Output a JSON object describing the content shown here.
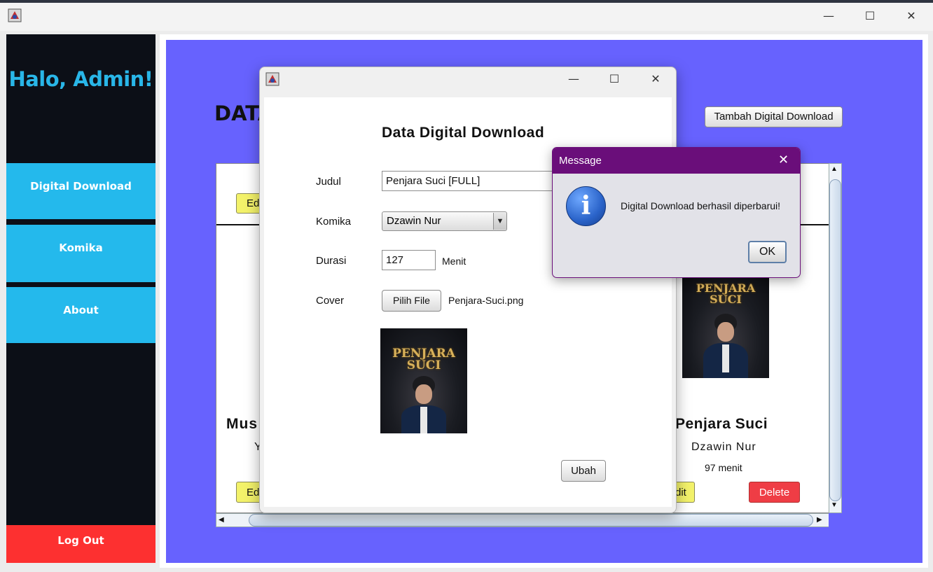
{
  "window": {
    "controls": {
      "minimize": "—",
      "maximize": "☐",
      "close": "✕"
    }
  },
  "sidebar": {
    "greeting": "Halo, Admin!",
    "items": [
      {
        "label": "Digital Download"
      },
      {
        "label": "Komika"
      },
      {
        "label": "About"
      }
    ],
    "logout": "Log Out"
  },
  "main": {
    "title_visible": "DATA",
    "add_button": "Tambah Digital Download",
    "cards": [
      {
        "title_visible": "Mus",
        "comic_visible": "Y",
        "edit_visible": "Ed",
        "top_edit_visible": "Ed"
      },
      {
        "title": "Penjara Suci",
        "comic": "Dzawin Nur",
        "duration": "97 menit",
        "edit_visible": "dit",
        "delete": "Delete",
        "poster_title": "PENJARA SUCI"
      }
    ]
  },
  "form_dialog": {
    "heading": "Data Digital Download",
    "fields": {
      "judul_label": "Judul",
      "judul_value": "Penjara Suci [FULL]",
      "komika_label": "Komika",
      "komika_value": "Dzawin Nur",
      "durasi_label": "Durasi",
      "durasi_value": "127",
      "durasi_unit": "Menit",
      "cover_label": "Cover",
      "cover_button": "Pilih File",
      "cover_file": "Penjara-Suci.png"
    },
    "preview_title": "PENJARA SUCI",
    "submit": "Ubah"
  },
  "message_dialog": {
    "title": "Message",
    "text": "Digital Download berhasil diperbarui!",
    "ok": "OK",
    "icon": "info-icon"
  },
  "colors": {
    "sidebar_bg": "#0c0f17",
    "accent_blue": "#24b9ec",
    "logout_red": "#fd3030",
    "content_purple": "#6762fe",
    "message_header": "#6a0e7a"
  }
}
